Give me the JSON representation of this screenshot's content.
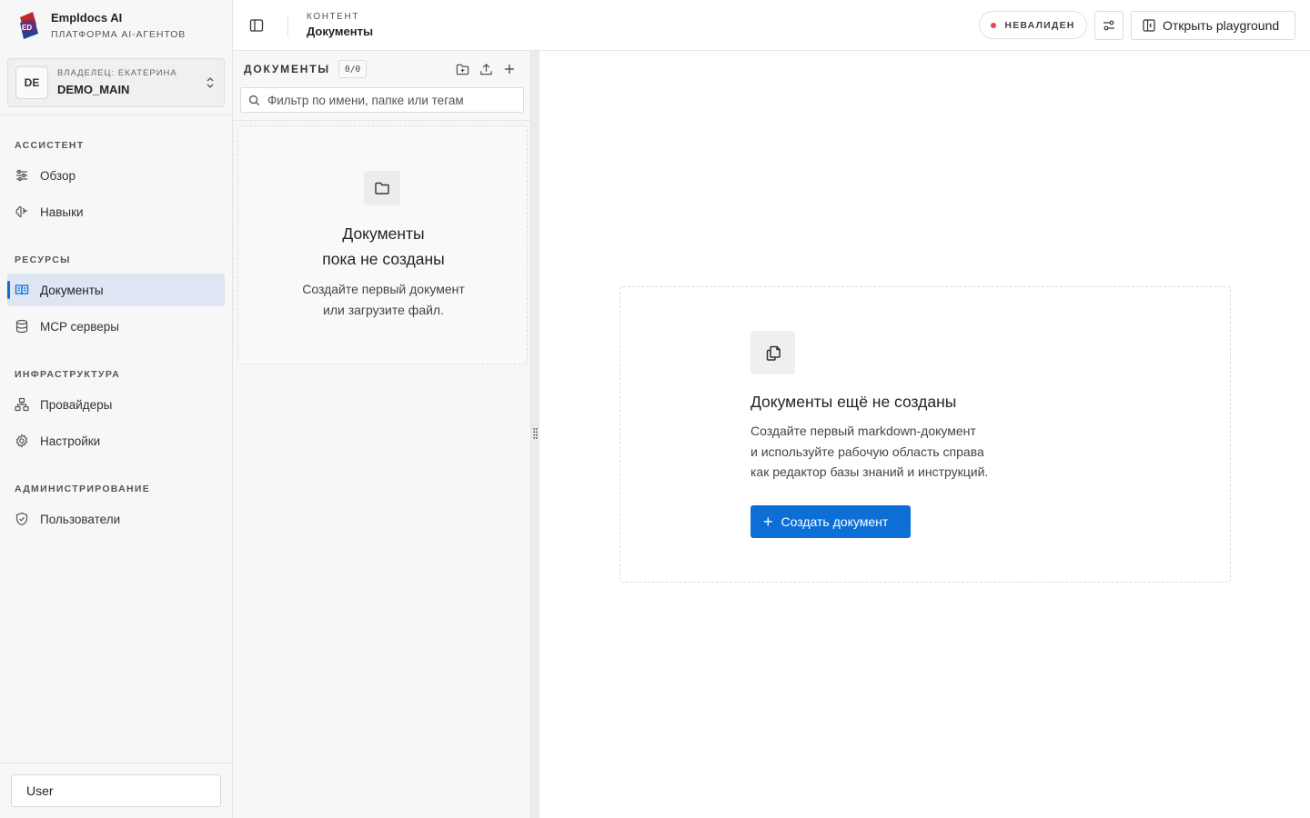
{
  "brand": {
    "title": "Empldocs AI",
    "subtitle": "Платформа AI-агентов",
    "logo_text": "ED"
  },
  "workspace": {
    "avatar": "DE",
    "owner": "Владелец: Екатерина",
    "name": "DEMO_MAIN"
  },
  "nav": {
    "sections": [
      {
        "title": "Ассистент",
        "items": [
          {
            "label": "Обзор",
            "icon": "sliders-icon"
          },
          {
            "label": "Навыки",
            "icon": "brain-icon"
          }
        ]
      },
      {
        "title": "Ресурсы",
        "items": [
          {
            "label": "Документы",
            "icon": "book-icon",
            "active": true
          },
          {
            "label": "MCP серверы",
            "icon": "database-icon"
          }
        ]
      },
      {
        "title": "Инфраструктура",
        "items": [
          {
            "label": "Провайдеры",
            "icon": "network-icon"
          },
          {
            "label": "Настройки",
            "icon": "gear-icon"
          }
        ]
      },
      {
        "title": "Администрирование",
        "items": [
          {
            "label": "Пользователи",
            "icon": "shield-icon"
          }
        ]
      }
    ]
  },
  "user": {
    "label": "User"
  },
  "topbar": {
    "section": "Контент",
    "title": "Документы",
    "status": "Невалиден",
    "status_color": "#e5484d",
    "playground_label": "Открыть playground"
  },
  "docs_panel": {
    "title": "Документы",
    "count": "0/0",
    "search_placeholder": "Фильтр по имени, папке или тегам",
    "empty_title_line1": "Документы",
    "empty_title_line2": "пока не созданы",
    "empty_text_line1": "Создайте первый документ",
    "empty_text_line2": "или загрузите файл."
  },
  "main": {
    "empty_title": "Документы ещё не созданы",
    "empty_text_line1": "Создайте первый markdown-документ",
    "empty_text_line2": "и используйте рабочую область справа",
    "empty_text_line3": "как редактор базы знаний и инструкций.",
    "create_button": "Создать документ",
    "accent": "#0d6fd6"
  }
}
